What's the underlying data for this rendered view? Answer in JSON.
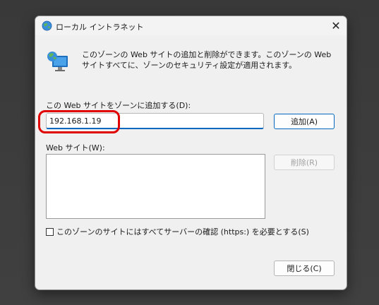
{
  "window": {
    "title": "ローカル イントラネット",
    "close_glyph": "✕"
  },
  "info": {
    "text": "このゾーンの Web サイトの追加と削除ができます。このゾーンの Web サイトすべてに、ゾーンのセキュリティ設定が適用されます。"
  },
  "add_site": {
    "label": "この Web サイトをゾーンに追加する(D):",
    "value": "192.168.1.19",
    "button_label": "追加(A)"
  },
  "sites": {
    "label": "Web サイト(W):",
    "items": [],
    "remove_label": "削除(R)"
  },
  "https_option": {
    "label": "このゾーンのサイトにはすべてサーバーの確認 (https:) を必要とする(S)",
    "checked": false
  },
  "footer": {
    "close_label": "閉じる(C)"
  },
  "icons": {
    "title": "globe-network-icon",
    "info": "globe-monitor-icon"
  },
  "colors": {
    "accent": "#0067c0",
    "highlight": "#e00000"
  }
}
